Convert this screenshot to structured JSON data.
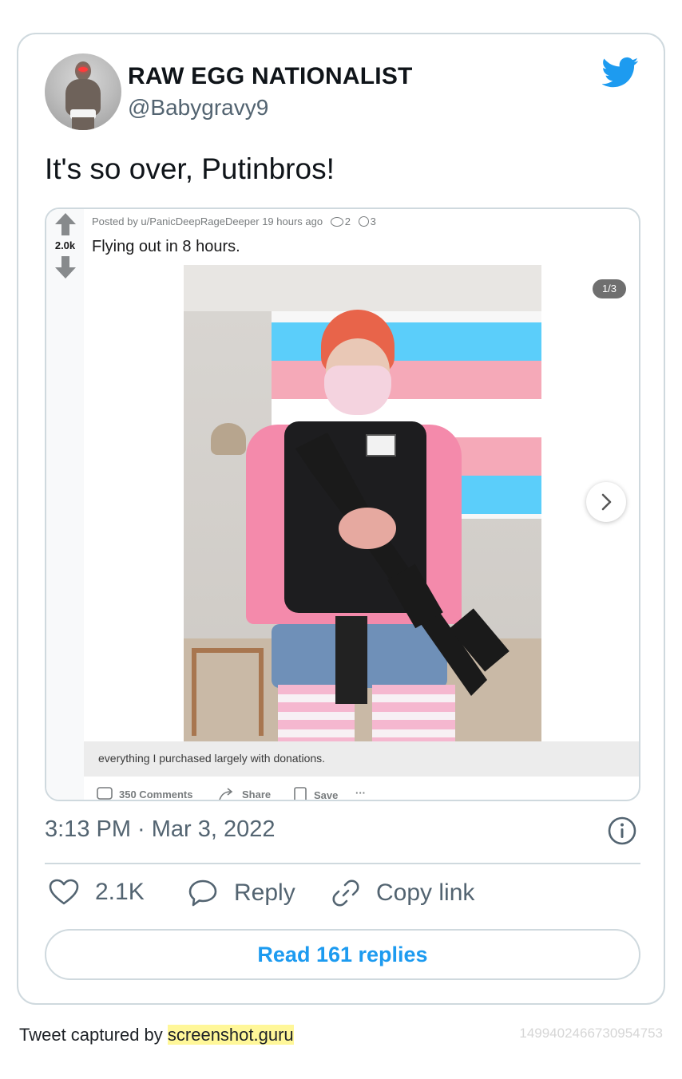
{
  "tweet": {
    "display_name": "RAW EGG NATIONALIST",
    "handle": "@Babygravy9",
    "text": "It's so over, Putinbros!",
    "timestamp": "3:13 PM · Mar 3, 2022",
    "likes": "2.1K",
    "reply_label": "Reply",
    "copy_label": "Copy link",
    "read_replies": "Read 161 replies",
    "brand_color": "#1d9bf0"
  },
  "embedded_post": {
    "vote_count": "2.0k",
    "meta": "Posted by u/PanicDeepRageDeeper 19 hours ago",
    "award_1": "2",
    "award_2": "3",
    "title": "Flying out in 8 hours.",
    "gallery_index": "1/3",
    "caption": "everything I purchased largely with donations.",
    "comments": "350 Comments",
    "share": "Share",
    "save": "Save",
    "more": "···"
  },
  "flag_colors": [
    "#5bcefa",
    "#f5a9b8",
    "#ffffff",
    "#f5a9b8",
    "#5bcefa"
  ],
  "footer": {
    "captured_prefix": "Tweet captured by ",
    "captured_site": "screenshot.guru",
    "tweet_id": "1499402466730954753"
  }
}
